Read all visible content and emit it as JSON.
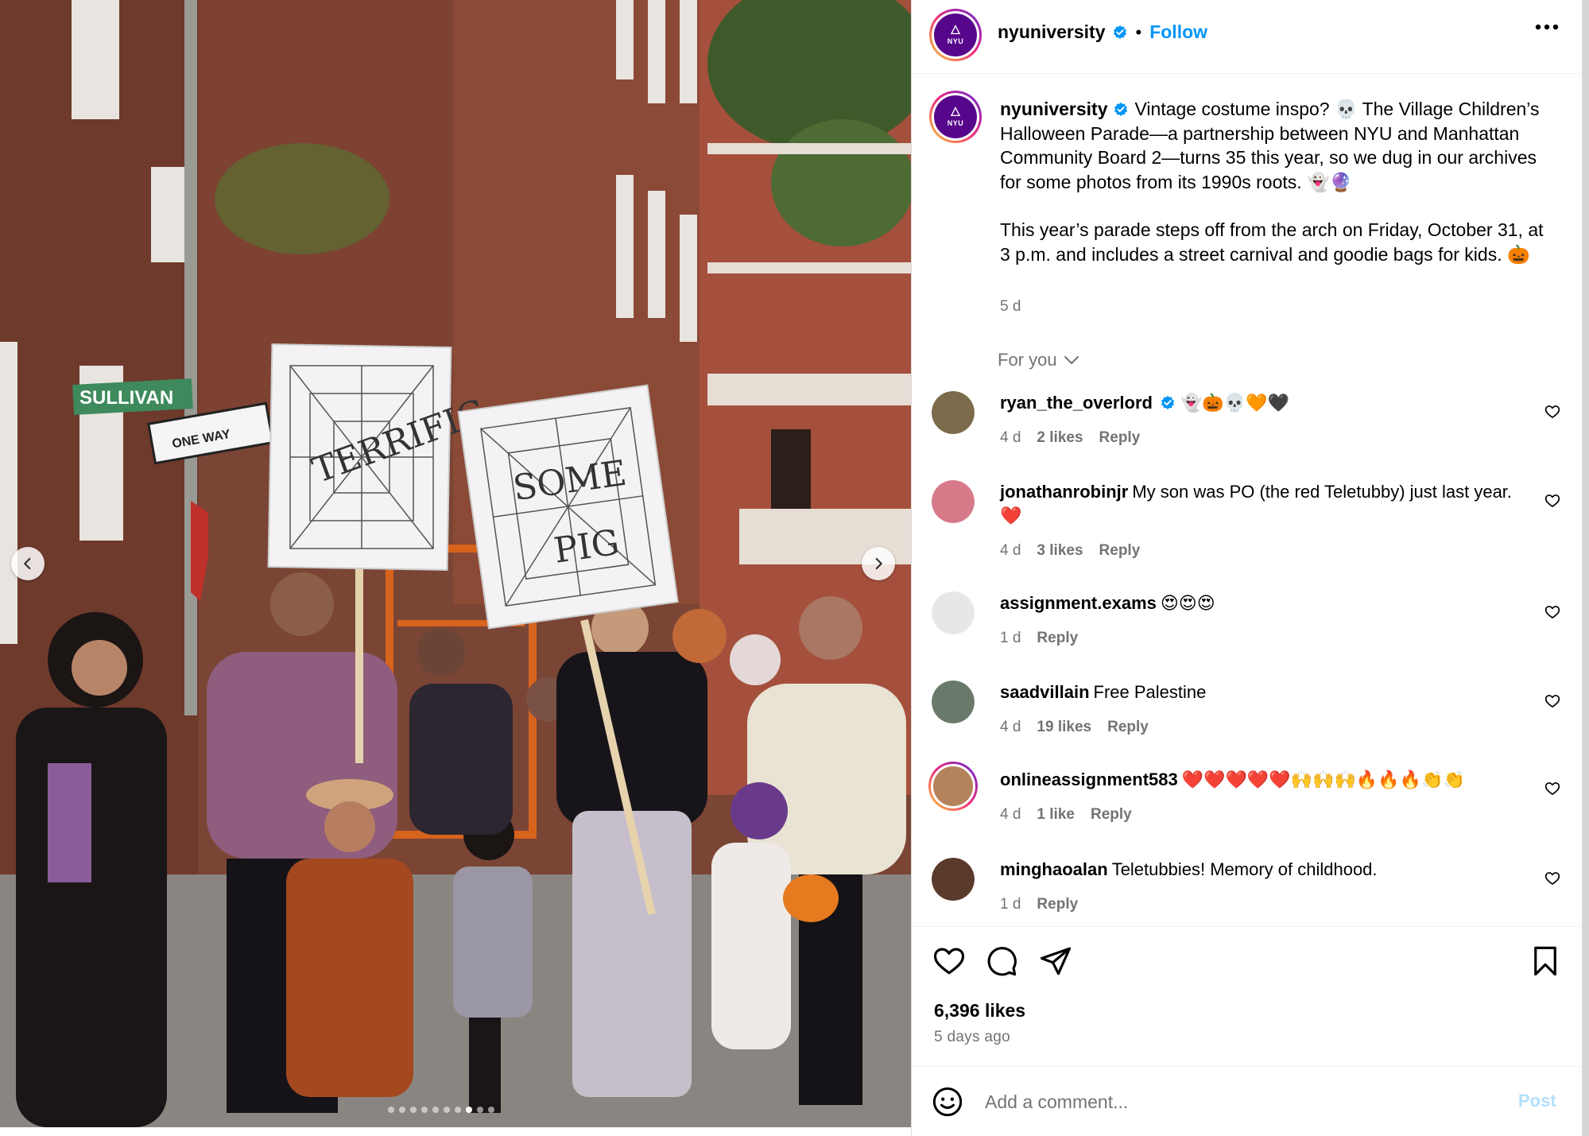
{
  "post": {
    "username": "nyuniversity",
    "follow_label": "Follow",
    "separator": "•",
    "avatar_text": "NYU",
    "caption_line1": "Vintage costume inspo? 💀 The Village Children’s Halloween Parade—a partnership between NYU and Manhattan Community Board 2—turns 35 this year, so we dug in our archives for some photos from its 1990s roots. 👻🔮",
    "caption_line2": "This year’s parade steps off from the arch on Friday, October 31, at 3 p.m. and includes a street carnival and goodie bags for kids. 🎃",
    "caption_time": "5 d",
    "likes": "6,396 likes",
    "posted_ago": "5 days ago"
  },
  "photo": {
    "sign_left": "TERRIFIC",
    "sign_right_1": "SOME",
    "sign_right_2": "PIG",
    "street_sign": "SULLIVAN",
    "one_way": "ONE WAY",
    "carousel_count": 10,
    "carousel_active": 8
  },
  "sort": {
    "label": "For you"
  },
  "comments": [
    {
      "username": "ryan_the_overlord",
      "verified": true,
      "text": "👻🎃💀🧡🖤",
      "time": "4 d",
      "likes": "2 likes",
      "reply": "Reply"
    },
    {
      "username": "jonathanrobinjr",
      "verified": false,
      "text": "My son was PO (the red Teletubby) just last year. ❤️",
      "time": "4 d",
      "likes": "3 likes",
      "reply": "Reply"
    },
    {
      "username": "assignment.exams",
      "verified": false,
      "text": "😍😍😍",
      "time": "1 d",
      "likes": "",
      "reply": "Reply"
    },
    {
      "username": "saadvillain",
      "verified": false,
      "text": "Free Palestine",
      "time": "4 d",
      "likes": "19 likes",
      "reply": "Reply"
    },
    {
      "username": "onlineassignment583",
      "verified": false,
      "text": "❤️❤️❤️❤️❤️🙌🙌🙌🔥🔥🔥👏👏",
      "time": "4 d",
      "likes": "1 like",
      "reply": "Reply"
    },
    {
      "username": "minghaoalan",
      "verified": false,
      "text": "Teletubbies!  Memory of childhood.",
      "time": "1 d",
      "likes": "",
      "reply": "Reply"
    }
  ],
  "composer": {
    "placeholder": "Add a comment...",
    "post_label": "Post"
  },
  "colors": {
    "follow_blue": "#0095f6",
    "verified_blue": "#0095f6",
    "nyu_purple": "#57068c",
    "secondary_text": "#737373",
    "post_disabled": "#b2dffc"
  },
  "icons": [
    "chevron-left-icon",
    "chevron-right-icon",
    "more-icon",
    "verified-icon",
    "chevron-down-icon",
    "heart-icon",
    "comment-icon",
    "share-icon",
    "bookmark-icon",
    "emoji-icon"
  ]
}
